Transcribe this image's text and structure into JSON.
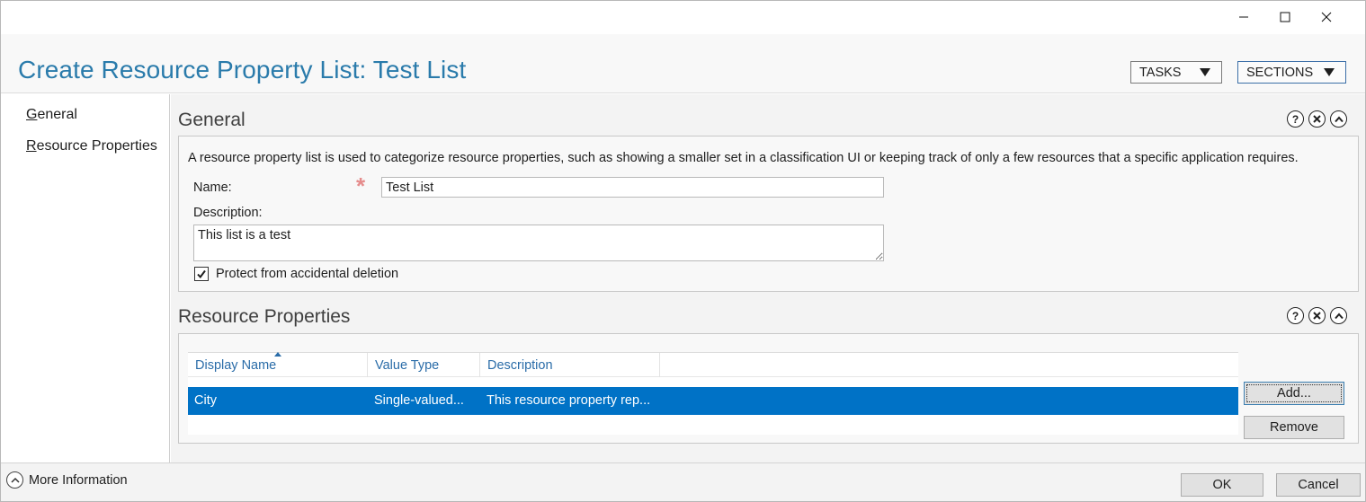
{
  "window": {
    "controls": [
      "minimize",
      "maximize",
      "close"
    ]
  },
  "header": {
    "title": "Create Resource Property List: Test List",
    "tasks_label": "TASKS",
    "sections_label": "SECTIONS"
  },
  "nav": {
    "items": [
      {
        "accel": "G",
        "rest": "eneral"
      },
      {
        "accel": "R",
        "rest": "esource Properties"
      }
    ]
  },
  "general": {
    "title": "General",
    "description": "A resource property list is used to categorize resource properties, such as showing a smaller set in a classification UI or keeping track of only a few resources that a specific application requires.",
    "name_label": "Name:",
    "name_value": "Test List",
    "description_label": "Description:",
    "description_value": "This list is a test",
    "protect_label": "Protect from accidental deletion",
    "protect_checked": true
  },
  "resource_properties": {
    "title": "Resource Properties",
    "columns": [
      "Display Name",
      "Value Type",
      "Description"
    ],
    "rows": [
      {
        "name": "City",
        "type": "Single-valued...",
        "description": "This resource property rep..."
      }
    ],
    "add_label": "Add...",
    "remove_label": "Remove"
  },
  "footer": {
    "more_info_label": "More Information",
    "ok_label": "OK",
    "cancel_label": "Cancel"
  },
  "colors": {
    "title_blue": "#2a7bab",
    "selection": "#0072c6",
    "header_link": "#2a6ca8"
  },
  "icons": {
    "section_icons": [
      "help-icon",
      "close-icon",
      "collapse-icon"
    ]
  }
}
